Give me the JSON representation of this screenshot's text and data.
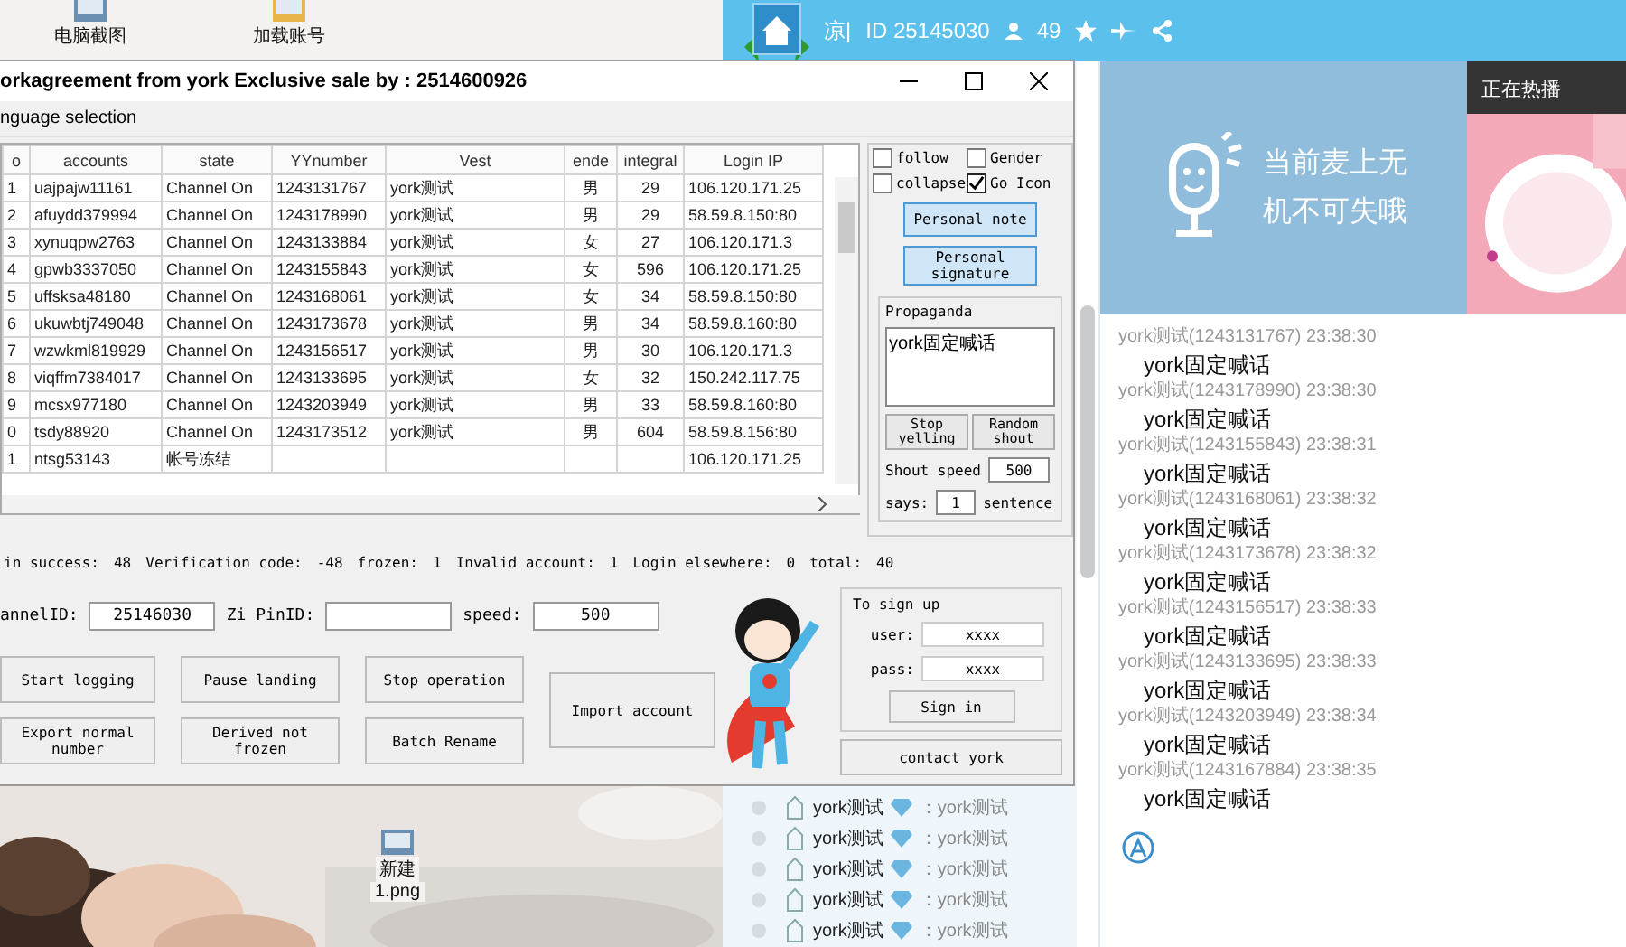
{
  "desktop_icons": [
    {
      "label": "电脑截图"
    },
    {
      "label": "加载账号"
    },
    {
      "label": "新建",
      "sublabel": "1.png"
    }
  ],
  "host_app": {
    "channel_name": "凉|",
    "channel_id": "ID 25145030",
    "viewers": "49",
    "mic_hint": [
      "当前麦上无",
      "机不可失哦"
    ],
    "hot_title": "正在热播",
    "chat": [
      {
        "meta": "york测试(1243131767) 23:38:30",
        "message": "york固定喊话"
      },
      {
        "meta": "york测试(1243178990) 23:38:30",
        "message": "york固定喊话"
      },
      {
        "meta": "york测试(1243155843) 23:38:31",
        "message": "york固定喊话"
      },
      {
        "meta": "york测试(1243168061) 23:38:32",
        "message": "york固定喊话"
      },
      {
        "meta": "york测试(1243173678) 23:38:32",
        "message": "york固定喊话"
      },
      {
        "meta": "york测试(1243156517) 23:38:33",
        "message": "york固定喊话"
      },
      {
        "meta": "york测试(1243133695) 23:38:33",
        "message": "york固定喊话"
      },
      {
        "meta": "york测试(1243203949) 23:38:34",
        "message": "york固定喊话"
      },
      {
        "meta": "york测试(1243167884) 23:38:35",
        "message": "york固定喊话"
      }
    ],
    "users": [
      {
        "name": "york测试",
        "text": "：york测试"
      },
      {
        "name": "york测试",
        "text": "：york测试"
      },
      {
        "name": "york测试",
        "text": "：york测试"
      },
      {
        "name": "york测试",
        "text": "：york测试"
      },
      {
        "name": "york测试",
        "text": "：york测试"
      }
    ]
  },
  "window": {
    "title": "orkagreement from york Exclusive sale by : 2514600926",
    "menu": [
      "nguage selection"
    ],
    "table": {
      "columns": [
        "o",
        "accounts",
        "state",
        "YYnumber",
        "Vest",
        "ende",
        "integral",
        "Login IP"
      ],
      "rows": [
        {
          "no": "1",
          "account": "uajpajw11161",
          "state": "Channel On",
          "yy": "1243131767",
          "vest": "york测试",
          "gender": "男",
          "integral": "29",
          "ip": "106.120.171.25"
        },
        {
          "no": "2",
          "account": "afuydd379994",
          "state": "Channel On",
          "yy": "1243178990",
          "vest": "york测试",
          "gender": "男",
          "integral": "29",
          "ip": "58.59.8.150:80"
        },
        {
          "no": "3",
          "account": "xynuqpw2763",
          "state": "Channel On",
          "yy": "1243133884",
          "vest": "york测试",
          "gender": "女",
          "integral": "27",
          "ip": "106.120.171.3"
        },
        {
          "no": "4",
          "account": "gpwb3337050",
          "state": "Channel On",
          "yy": "1243155843",
          "vest": "york测试",
          "gender": "女",
          "integral": "596",
          "ip": "106.120.171.25"
        },
        {
          "no": "5",
          "account": "uffsksa48180",
          "state": "Channel On",
          "yy": "1243168061",
          "vest": "york测试",
          "gender": "女",
          "integral": "34",
          "ip": "58.59.8.150:80"
        },
        {
          "no": "6",
          "account": "ukuwbtj749048",
          "state": "Channel On",
          "yy": "1243173678",
          "vest": "york测试",
          "gender": "男",
          "integral": "34",
          "ip": "58.59.8.160:80"
        },
        {
          "no": "7",
          "account": "wzwkml819929",
          "state": "Channel On",
          "yy": "1243156517",
          "vest": "york测试",
          "gender": "男",
          "integral": "30",
          "ip": "106.120.171.3"
        },
        {
          "no": "8",
          "account": "viqffm7384017",
          "state": "Channel On",
          "yy": "1243133695",
          "vest": "york测试",
          "gender": "女",
          "integral": "32",
          "ip": "150.242.117.75"
        },
        {
          "no": "9",
          "account": "mcsx977180",
          "state": "Channel On",
          "yy": "1243203949",
          "vest": "york测试",
          "gender": "男",
          "integral": "33",
          "ip": "58.59.8.160:80"
        },
        {
          "no": "0",
          "account": "tsdy88920",
          "state": "Channel On",
          "yy": "1243173512",
          "vest": "york测试",
          "gender": "男",
          "integral": "604",
          "ip": "58.59.8.156:80"
        },
        {
          "no": "1",
          "account": "ntsg53143",
          "state": "帐号冻结",
          "ip": "106.120.171.25"
        }
      ]
    },
    "options": [
      {
        "label": "follow",
        "checked": false
      },
      {
        "label": "Gender",
        "checked": false
      },
      {
        "label": "collapse",
        "checked": false
      },
      {
        "label": "Go Icon",
        "checked": true
      }
    ],
    "side_buttons": [
      "Personal note",
      "Personal signature"
    ],
    "propaganda": {
      "label": "Propaganda",
      "text": "york固定喊话"
    },
    "shout_buttons": [
      "Stop yelling",
      "Random shout"
    ],
    "shout_speed": {
      "label": "Shout speed",
      "value": "500"
    },
    "says": {
      "label": "says:",
      "value": "1",
      "suffix": "sentence"
    },
    "stats": [
      {
        "label": "in success:",
        "value": "48"
      },
      {
        "label": "Verification code:",
        "value": "-48"
      },
      {
        "label": "frozen:",
        "value": "1"
      },
      {
        "label": "Invalid account:",
        "value": "1"
      },
      {
        "label": "Login elsewhere:",
        "value": "0"
      },
      {
        "label": "total:",
        "value": "40"
      }
    ],
    "fields": [
      {
        "label": "annelID:",
        "value": "25146030"
      },
      {
        "label": "Zi PinID:"
      },
      {
        "label": "speed:",
        "value": "500"
      }
    ],
    "buttons": [
      "Start logging",
      "Pause landing",
      "Stop operation",
      "Export normal number",
      "Derived not frozen",
      "Batch Rename"
    ],
    "import_button": "Import account",
    "signup": {
      "title": "To sign up",
      "user_label": "user:",
      "user": "xxxx",
      "pass_label": "pass:",
      "pass": "xxxx",
      "button": "Sign in"
    },
    "contact_button": "contact york"
  }
}
